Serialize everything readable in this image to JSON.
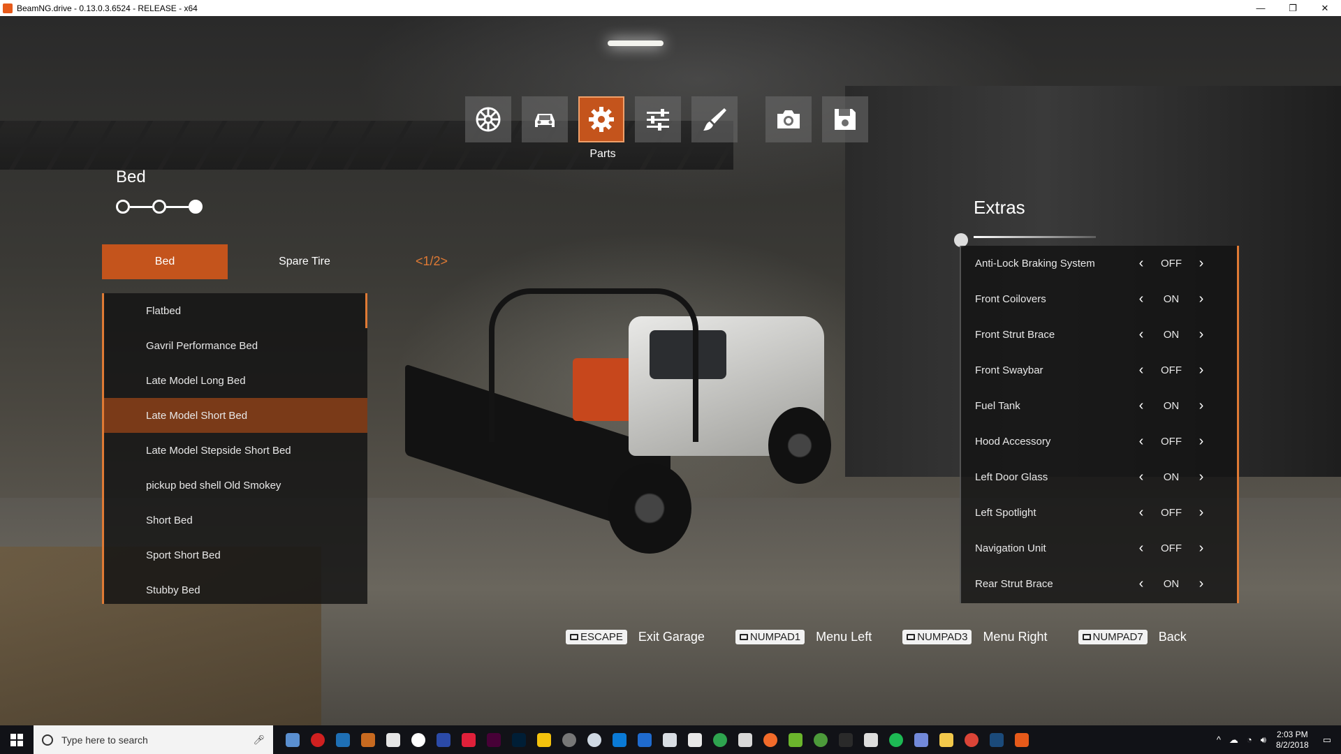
{
  "window": {
    "title": "BeamNG.drive - 0.13.0.3.6524 - RELEASE - x64",
    "minimize": "—",
    "restore": "❐",
    "close": "✕"
  },
  "top_menu": {
    "active_label": "Parts",
    "buttons": [
      {
        "icon": "wheel-icon"
      },
      {
        "icon": "car-icon"
      },
      {
        "icon": "gear-icon",
        "active": true
      },
      {
        "icon": "sliders-icon"
      },
      {
        "icon": "brush-icon"
      },
      {
        "icon": "camera-icon"
      },
      {
        "icon": "save-icon"
      }
    ]
  },
  "breadcrumb": {
    "title": "Bed"
  },
  "tabs": {
    "active": "Bed",
    "inactive": "Spare Tire",
    "page_indicator": "<1/2>"
  },
  "parts_list": {
    "items": [
      "Flatbed",
      "Gavril Performance Bed",
      "Late Model Long Bed",
      "Late Model Short Bed",
      "Late Model Stepside Short Bed",
      "pickup bed shell Old Smokey",
      "Short Bed",
      "Sport Short Bed",
      "Stubby Bed"
    ],
    "selected_index": 3
  },
  "extras": {
    "title": "Extras",
    "options": [
      {
        "name": "Anti-Lock Braking System",
        "value": "OFF"
      },
      {
        "name": "Front Coilovers",
        "value": "ON"
      },
      {
        "name": "Front Strut Brace",
        "value": "ON"
      },
      {
        "name": "Front Swaybar",
        "value": "OFF"
      },
      {
        "name": "Fuel Tank",
        "value": "ON"
      },
      {
        "name": "Hood Accessory",
        "value": "OFF"
      },
      {
        "name": "Left Door Glass",
        "value": "ON"
      },
      {
        "name": "Left Spotlight",
        "value": "OFF"
      },
      {
        "name": "Navigation Unit",
        "value": "OFF"
      },
      {
        "name": "Rear Strut Brace",
        "value": "ON"
      }
    ]
  },
  "hints": [
    {
      "key": "ESCAPE",
      "label": "Exit Garage"
    },
    {
      "key": "NUMPAD1",
      "label": "Menu Left"
    },
    {
      "key": "NUMPAD3",
      "label": "Menu Right"
    },
    {
      "key": "NUMPAD7",
      "label": "Back"
    }
  ],
  "taskbar": {
    "search_placeholder": "Type here to search",
    "time": "2:03 PM",
    "date": "8/2/2018"
  },
  "colors": {
    "accent": "#c4541c",
    "accent_light": "#e07a34",
    "selected_row": "#7a3a18"
  }
}
